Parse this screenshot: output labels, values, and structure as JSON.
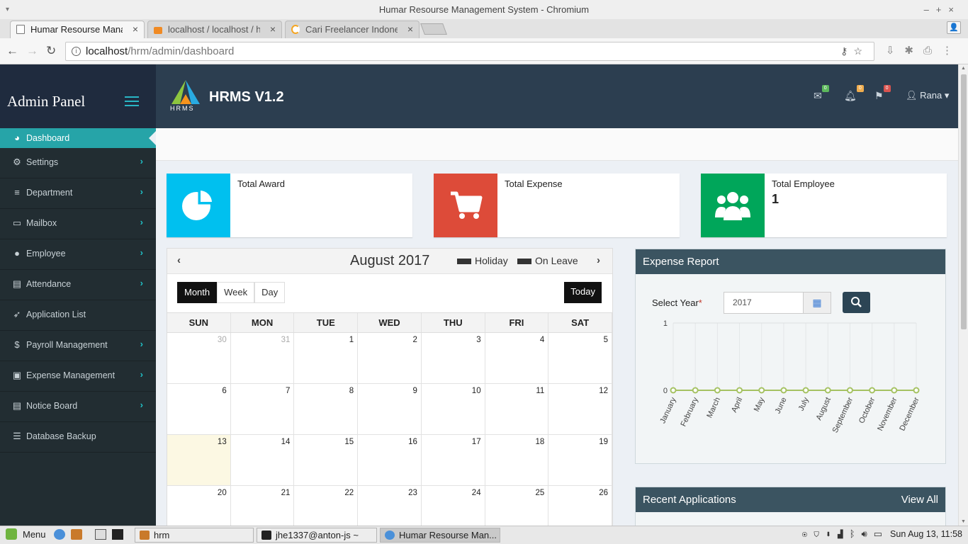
{
  "window": {
    "title": "Humar Resourse Management System - Chromium"
  },
  "tabs": [
    {
      "title": "Humar Resourse Management System"
    },
    {
      "title": "localhost / localhost / hrm"
    },
    {
      "title": "Cari Freelancer Indonesia"
    }
  ],
  "address": {
    "host": "localhost",
    "path": "/hrm/admin/dashboard"
  },
  "sidebar": {
    "brand": "Admin Panel",
    "items": [
      {
        "label": "Dashboard",
        "icon": "dashboard-icon"
      },
      {
        "label": "Settings",
        "icon": "gears-icon"
      },
      {
        "label": "Department",
        "icon": "department-icon"
      },
      {
        "label": "Mailbox",
        "icon": "mailbox-icon"
      },
      {
        "label": "Employee",
        "icon": "user-icon"
      },
      {
        "label": "Attendance",
        "icon": "document-icon"
      },
      {
        "label": "Application List",
        "icon": "rocket-icon"
      },
      {
        "label": "Payroll Management",
        "icon": "dollar-icon"
      },
      {
        "label": "Expense Management",
        "icon": "money-icon"
      },
      {
        "label": "Notice Board",
        "icon": "board-icon"
      },
      {
        "label": "Database Backup",
        "icon": "database-icon"
      }
    ]
  },
  "header": {
    "logo_text": "HRMS",
    "app_title": "HRMS V1.2",
    "mail_count": "0",
    "bell_count": "0",
    "flag_count": "0",
    "user": "Rana",
    "colors": {
      "mail_badge": "#5cb85c",
      "bell_badge": "#f0ad4e",
      "flag_badge": "#d9534f"
    }
  },
  "stats": [
    {
      "label": "Total Award",
      "value": "",
      "color": "#00c0ef",
      "icon": "pie-chart-icon"
    },
    {
      "label": "Total Expense",
      "value": "",
      "color": "#dd4b39",
      "icon": "cart-icon"
    },
    {
      "label": "Total Employee",
      "value": "1",
      "color": "#00a65a",
      "icon": "users-icon"
    }
  ],
  "calendar": {
    "title": "August 2017",
    "legend": {
      "holiday": "Holiday",
      "on_leave": "On Leave"
    },
    "views": [
      "Month",
      "Week",
      "Day"
    ],
    "active_view": "Month",
    "today_label": "Today",
    "weekdays": [
      "SUN",
      "MON",
      "TUE",
      "WED",
      "THU",
      "FRI",
      "SAT"
    ],
    "weeks": [
      [
        "30",
        "31",
        "1",
        "2",
        "3",
        "4",
        "5"
      ],
      [
        "6",
        "7",
        "8",
        "9",
        "10",
        "11",
        "12"
      ],
      [
        "13",
        "14",
        "15",
        "16",
        "17",
        "18",
        "19"
      ],
      [
        "20",
        "21",
        "22",
        "23",
        "24",
        "25",
        "26"
      ]
    ],
    "other_month_days": [
      "30",
      "31"
    ],
    "today": "13"
  },
  "expense": {
    "title": "Expense Report",
    "select_year_label": "Select Year",
    "required_mark": "*",
    "year_value": "2017"
  },
  "chart_data": {
    "type": "line",
    "x": [
      "January",
      "February",
      "March",
      "April",
      "May",
      "June",
      "July",
      "August",
      "September",
      "October",
      "November",
      "December"
    ],
    "series": [
      {
        "values": [
          0,
          0,
          0,
          0,
          0,
          0,
          0,
          0,
          0,
          0,
          0,
          0
        ]
      }
    ],
    "ylim": [
      0,
      1
    ],
    "yticks": [
      "0",
      "1"
    ],
    "grid": true,
    "line_color": "#a5c262"
  },
  "recent": {
    "title": "Recent Applications",
    "view_all": "View All"
  },
  "taskbar": {
    "menu": "Menu",
    "items": [
      {
        "label": "hrm"
      },
      {
        "label": "jhe1337@anton-js ~"
      },
      {
        "label": "Humar Resourse Man..."
      }
    ],
    "clock": "Sun Aug 13, 11:58"
  }
}
